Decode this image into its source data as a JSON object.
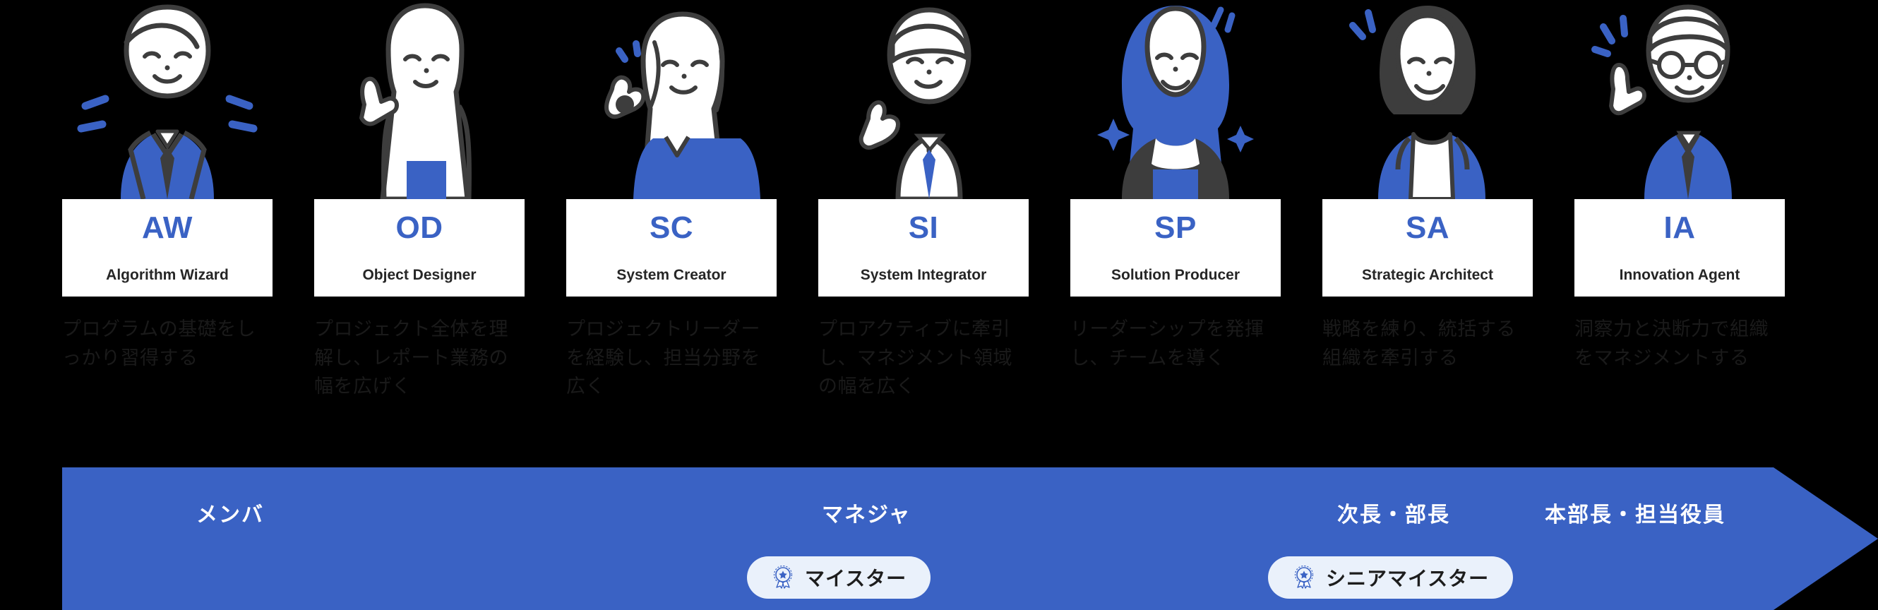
{
  "theme": {
    "background": "#000000",
    "accent_blue": "#3a62c4",
    "card_background": "#ffffff",
    "pill_background": "#eaf1fb",
    "band_text": "#ffffff"
  },
  "roles": [
    {
      "abbr": "AW",
      "full": "Algorithm Wizard",
      "description": "プログラムの基礎をしっかり習得する",
      "avatar": "avatar-algorithm-wizard"
    },
    {
      "abbr": "OD",
      "full": "Object Designer",
      "description": "プロジェクト全体を理解し、レポート業務の幅を広げく",
      "avatar": "avatar-object-designer"
    },
    {
      "abbr": "SC",
      "full": "System Creator",
      "description": "プロジェクトリーダーを経験し、担当分野を広く",
      "avatar": "avatar-system-creator"
    },
    {
      "abbr": "SI",
      "full": "System Integrator",
      "description": "プロアクティブに牽引し、マネジメント領域の幅を広く",
      "avatar": "avatar-system-integrator"
    },
    {
      "abbr": "SP",
      "full": "Solution Producer",
      "description": "リーダーシップを発揮し、チームを導く",
      "avatar": "avatar-solution-producer"
    },
    {
      "abbr": "SA",
      "full": "Strategic Architect",
      "description": "戦略を練り、統括する組織を牽引する",
      "avatar": "avatar-strategic-architect"
    },
    {
      "abbr": "IA",
      "full": "Innovation Agent",
      "description": "洞察力と決断力で組織をマネジメントする",
      "avatar": "avatar-innovation-agent"
    }
  ],
  "band": {
    "labels": {
      "member": "メンバ",
      "manager": "マネジャ",
      "jicho_bucho": "次長・部長",
      "honbucho_yakuin": "本部長・担当役員"
    },
    "pills": [
      {
        "label": "マイスター",
        "icon": "rosette-icon"
      },
      {
        "label": "シニアマイスター",
        "icon": "rosette-icon"
      }
    ]
  }
}
